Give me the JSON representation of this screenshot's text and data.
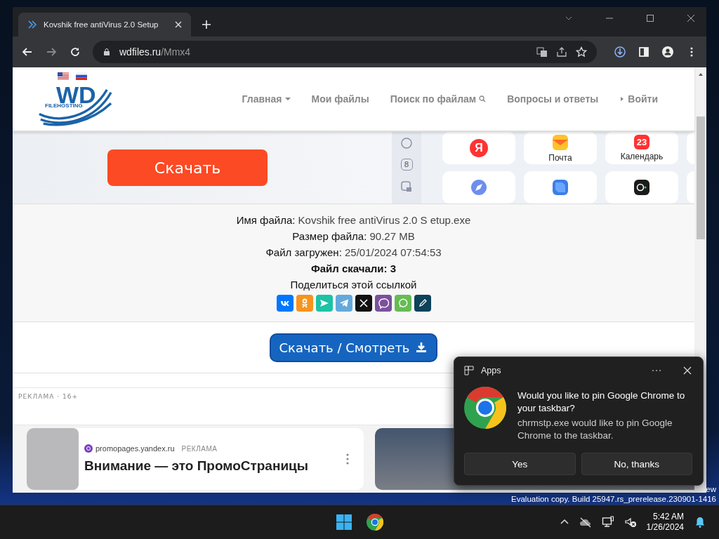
{
  "desktop": {
    "build_lines": [
      "ew",
      "Evaluation copy. Build 25947.rs_prerelease.230901-1416"
    ]
  },
  "browser": {
    "tab": {
      "title": "Kovshik free antiVirus 2.0 Setup",
      "selected": true
    },
    "address": {
      "host": "wdfiles.ru",
      "path": "/Mmx4"
    }
  },
  "site": {
    "logo": {
      "mark": "WD",
      "caption": "FILEHOSTING"
    },
    "nav": [
      {
        "label": "Главная",
        "kind": "caret"
      },
      {
        "label": "Мои файлы",
        "kind": "plain"
      },
      {
        "label": "Поиск по файлам",
        "kind": "search"
      },
      {
        "label": "Вопросы и ответы",
        "kind": "plain"
      },
      {
        "label": "Войти",
        "kind": "arrow"
      }
    ]
  },
  "banner": {
    "button": "Скачать",
    "side_badge": "8",
    "tiles": [
      {
        "kind": "yandex",
        "glyph": "Я"
      },
      {
        "kind": "mail",
        "label": "Почта"
      },
      {
        "kind": "calendar",
        "glyph": "23",
        "label": "Календарь"
      },
      {
        "kind": "blank"
      },
      {
        "kind": "compass"
      },
      {
        "kind": "cube"
      },
      {
        "kind": "camera"
      },
      {
        "kind": "blank"
      }
    ]
  },
  "file_info": {
    "lines": [
      {
        "label": "Имя файла:",
        "value": "Kovshik free antiVirus 2.0 S etup.exe"
      },
      {
        "label": "Размер файла:",
        "value": "90.27 MB"
      },
      {
        "label": "Файл загружен:",
        "value": "25/01/2024 07:54:53"
      }
    ],
    "downloads": "Файл скачали: 3",
    "share_label": "Поделиться этой ссылкой",
    "share": [
      {
        "kind": "vk",
        "color": "#0077ff"
      },
      {
        "kind": "ok",
        "color": "#f7931e"
      },
      {
        "kind": "send",
        "color": "#1ec2a4"
      },
      {
        "kind": "telegram",
        "color": "#64a9dc"
      },
      {
        "kind": "x",
        "color": "#111111"
      },
      {
        "kind": "viber",
        "color": "#7b519d"
      },
      {
        "kind": "whatsapp",
        "color": "#65bc54"
      },
      {
        "kind": "pen",
        "color": "#0d425a"
      }
    ]
  },
  "download_button": "Скачать / Смотреть",
  "ad": {
    "label": "РЕКЛАМА · 16+",
    "source": "promopages.yandex.ru",
    "tag": "РЕКЛАМА",
    "headline": "Внимание — это ПромоСтраницы"
  },
  "toast": {
    "app": "Apps",
    "title": "Would you like to pin Google Chrome to your taskbar?",
    "body": "chrmstp.exe would like to pin Google Chrome to the taskbar.",
    "buttons": [
      "Yes",
      "No, thanks"
    ]
  },
  "taskbar": {
    "time": "5:42 AM",
    "date": "1/26/2024"
  }
}
